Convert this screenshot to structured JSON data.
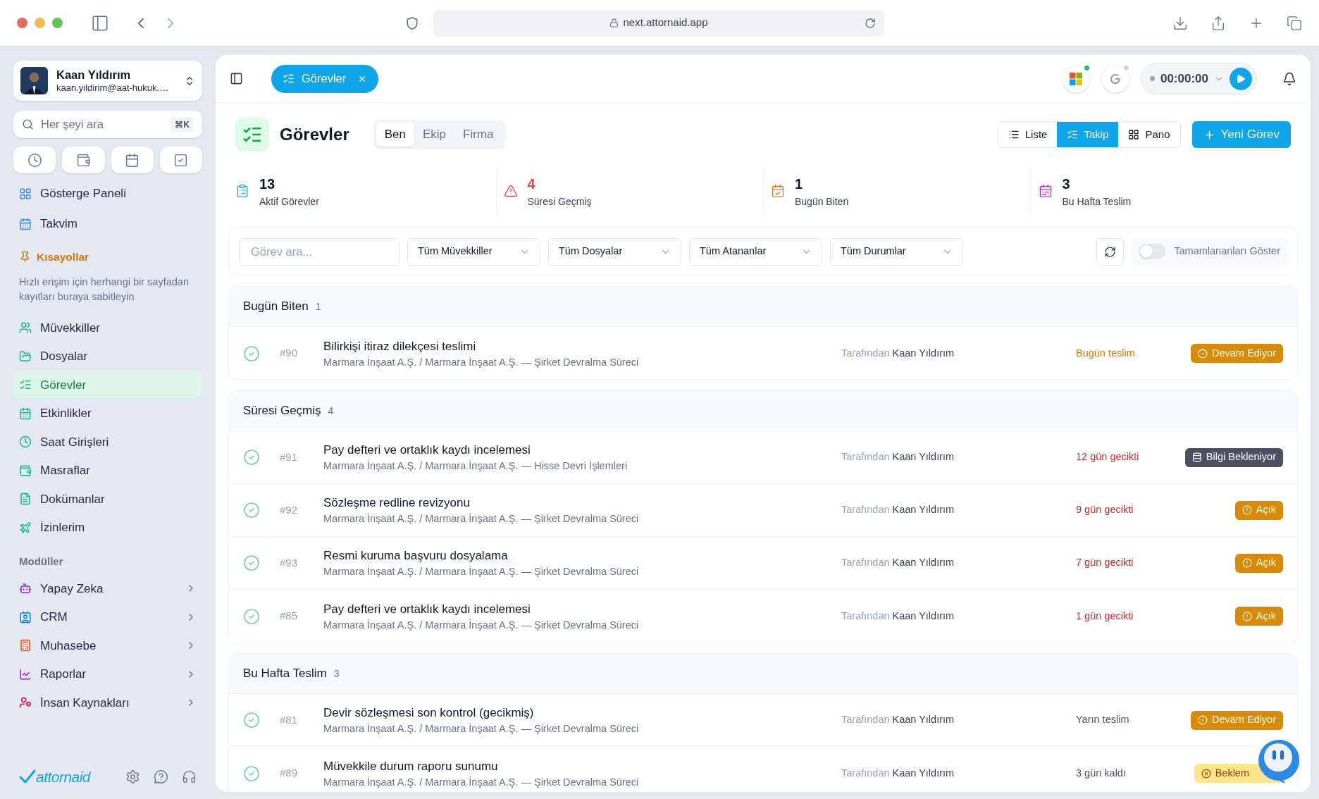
{
  "browser": {
    "url": "next.attornaid.app"
  },
  "user": {
    "name": "Kaan Yıldırım",
    "email": "kaan.yildirim@aat-hukuk.…"
  },
  "search": {
    "placeholder": "Her şeyi ara",
    "shortcut": "⌘K"
  },
  "nav_top": [
    {
      "label": "Gösterge Paneli",
      "selected": false
    },
    {
      "label": "Takvim",
      "selected": false
    }
  ],
  "shortcuts": {
    "title": "Kısayollar",
    "hint": "Hızlı erişim için herhangi bir sayfadan kayıtları buraya sabitleyin"
  },
  "nav_main": [
    {
      "label": "Müvekkiller",
      "selected": false
    },
    {
      "label": "Dosyalar",
      "selected": false
    },
    {
      "label": "Görevler",
      "selected": true
    },
    {
      "label": "Etkinlikler",
      "selected": false
    },
    {
      "label": "Saat Girişleri",
      "selected": false
    },
    {
      "label": "Masraflar",
      "selected": false
    },
    {
      "label": "Dokümanlar",
      "selected": false
    },
    {
      "label": "İzinlerim",
      "selected": false
    }
  ],
  "modules": {
    "title": "Modüller",
    "items": [
      {
        "label": "Yapay Zeka",
        "expanded": false
      },
      {
        "label": "CRM",
        "expanded": false
      },
      {
        "label": "Muhasebe",
        "expanded": false
      },
      {
        "label": "Raporlar",
        "expanded": false
      },
      {
        "label": "İnsan Kaynakları",
        "expanded": false
      }
    ]
  },
  "logo": "attornaid",
  "open_tab": {
    "label": "Görevler"
  },
  "integrations": [
    {
      "connected": true
    },
    {
      "connected": false
    }
  ],
  "timer": {
    "time": "00:00:00",
    "running": false
  },
  "page": {
    "title": "Görevler",
    "scopes": [
      {
        "label": "Ben",
        "selected": true
      },
      {
        "label": "Ekip",
        "selected": false
      },
      {
        "label": "Firma",
        "selected": false
      }
    ],
    "views": [
      {
        "label": "Liste",
        "selected": false
      },
      {
        "label": "Takip",
        "selected": true
      },
      {
        "label": "Pano",
        "selected": false
      }
    ],
    "new_button": "Yeni Görev"
  },
  "stats": [
    {
      "value": "13",
      "label": "Aktif Görevler",
      "color": "#0ea5e9"
    },
    {
      "value": "4",
      "label": "Süresi Geçmiş",
      "color": "#ef4444"
    },
    {
      "value": "1",
      "label": "Bugün Biten",
      "color": "#f97316"
    },
    {
      "value": "3",
      "label": "Bu Hafta Teslim",
      "color": "#c026d3"
    }
  ],
  "filters": {
    "search_placeholder": "Görev ara...",
    "selects": [
      "Tüm Müvekkiller",
      "Tüm Dosyalar",
      "Tüm Atananlar",
      "Tüm Durumlar"
    ],
    "show_completed": {
      "label": "Tamamlananları Göster",
      "on": false
    }
  },
  "groups": [
    {
      "title": "Bugün Biten",
      "count": "1",
      "tasks": [
        {
          "id": "#90",
          "title": "Bilirkişi itiraz dilekçesi teslimi",
          "path": "Marmara İnşaat A.Ş. / Marmara İnşaat A.Ş. — Şirket Devralma Süreci",
          "by_label": "Tarafından",
          "by": "Kaan Yıldırım",
          "due": {
            "text": "Bugün teslim",
            "kind": "today"
          },
          "status": {
            "text": "Devam Ediyor",
            "kind": "in_progress"
          }
        }
      ]
    },
    {
      "title": "Süresi Geçmiş",
      "count": "4",
      "tasks": [
        {
          "id": "#91",
          "title": "Pay defteri ve ortaklık kaydı incelemesi",
          "path": "Marmara İnşaat A.Ş. / Marmara İnşaat A.Ş. — Hisse Devri İşlemleri",
          "by_label": "Tarafından",
          "by": "Kaan Yıldırım",
          "due": {
            "text": "12 gün gecikti",
            "kind": "overdue"
          },
          "status": {
            "text": "Bilgi Bekleniyor",
            "kind": "info_waiting"
          }
        },
        {
          "id": "#92",
          "title": "Sözleşme redline revizyonu",
          "path": "Marmara İnşaat A.Ş. / Marmara İnşaat A.Ş. — Şirket Devralma Süreci",
          "by_label": "Tarafından",
          "by": "Kaan Yıldırım",
          "due": {
            "text": "9 gün gecikti",
            "kind": "overdue"
          },
          "status": {
            "text": "Açık",
            "kind": "open"
          }
        },
        {
          "id": "#93",
          "title": "Resmi kuruma başvuru dosyalama",
          "path": "Marmara İnşaat A.Ş. / Marmara İnşaat A.Ş. — Şirket Devralma Süreci",
          "by_label": "Tarafından",
          "by": "Kaan Yıldırım",
          "due": {
            "text": "7 gün gecikti",
            "kind": "overdue"
          },
          "status": {
            "text": "Açık",
            "kind": "open"
          }
        },
        {
          "id": "#85",
          "title": "Pay defteri ve ortaklık kaydı incelemesi",
          "path": "Marmara İnşaat A.Ş. / Marmara İnşaat A.Ş. — Şirket Devralma Süreci",
          "by_label": "Tarafından",
          "by": "Kaan Yıldırım",
          "due": {
            "text": "1 gün gecikti",
            "kind": "overdue"
          },
          "status": {
            "text": "Açık",
            "kind": "open"
          }
        }
      ]
    },
    {
      "title": "Bu Hafta Teslim",
      "count": "3",
      "tasks": [
        {
          "id": "#81",
          "title": "Devir sözleşmesi son kontrol (gecikmiş)",
          "path": "Marmara İnşaat A.Ş. / Marmara İnşaat A.Ş. — Şirket Devralma Süreci",
          "by_label": "Tarafından",
          "by": "Kaan Yıldırım",
          "due": {
            "text": "Yarın teslim",
            "kind": "normal"
          },
          "status": {
            "text": "Devam Ediyor",
            "kind": "in_progress"
          }
        },
        {
          "id": "#89",
          "title": "Müvekkile durum raporu sunumu",
          "path": "Marmara İnşaat A.Ş. / Marmara İnşaat A.Ş. — Şirket Devralma Süreci",
          "by_label": "Tarafından",
          "by": "Kaan Yıldırım",
          "due": {
            "text": "3 gün kaldı",
            "kind": "normal"
          },
          "status": {
            "text": "Beklem",
            "kind": "waiting"
          }
        }
      ]
    }
  ]
}
